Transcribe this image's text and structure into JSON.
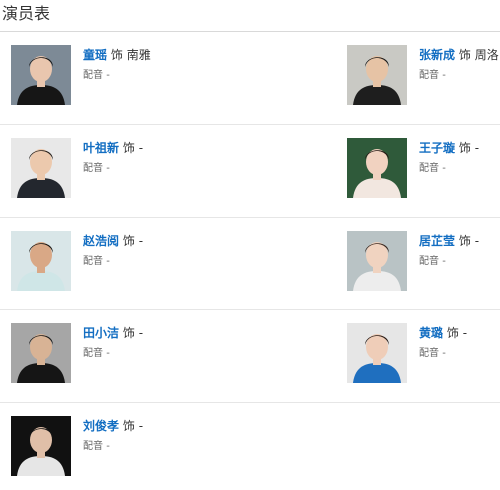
{
  "page": {
    "title": "演员表"
  },
  "labels": {
    "plays": "饰",
    "dub": "配音"
  },
  "cast": [
    {
      "name": "童瑶",
      "role": "南雅",
      "dub": "-",
      "bg": "#7d8a96",
      "hair": "#1b1b1b",
      "shirt": "#161616",
      "skin": "#e9c6ae"
    },
    {
      "name": "张新成",
      "role": "周洛",
      "dub": "-",
      "bg": "#c9c9c4",
      "hair": "#1a1a1a",
      "shirt": "#1e1e1e",
      "skin": "#e6c3a5"
    },
    {
      "name": "叶祖新",
      "role": "-",
      "dub": "-",
      "bg": "#e8e8e8",
      "hair": "#2a241f",
      "shirt": "#23272e",
      "skin": "#ecc9ad"
    },
    {
      "name": "王子璇",
      "role": "-",
      "dub": "-",
      "bg": "#2f5a3a",
      "hair": "#241814",
      "shirt": "#f2e7e0",
      "skin": "#f1d2c0"
    },
    {
      "name": "赵浩阅",
      "role": "-",
      "dub": "-",
      "bg": "#d9e6e8",
      "hair": "#1f1b17",
      "shirt": "#cfe6e7",
      "skin": "#d9a886"
    },
    {
      "name": "居芷莹",
      "role": "-",
      "dub": "-",
      "bg": "#b9c3c5",
      "hair": "#3a2a22",
      "shirt": "#ededed",
      "skin": "#f0d3c0"
    },
    {
      "name": "田小洁",
      "role": "-",
      "dub": "-",
      "bg": "#a6a6a6",
      "hair": "#1c1c1c",
      "shirt": "#151515",
      "skin": "#d8b395"
    },
    {
      "name": "黄璐",
      "role": "-",
      "dub": "-",
      "bg": "#e6e6e6",
      "hair": "#2a1d17",
      "shirt": "#1f6fbf",
      "skin": "#efcdb8"
    },
    {
      "name": "刘俊孝",
      "role": "-",
      "dub": "-",
      "bg": "#111111",
      "hair": "#141414",
      "shirt": "#e6e6e6",
      "skin": "#e0bfa8"
    }
  ]
}
